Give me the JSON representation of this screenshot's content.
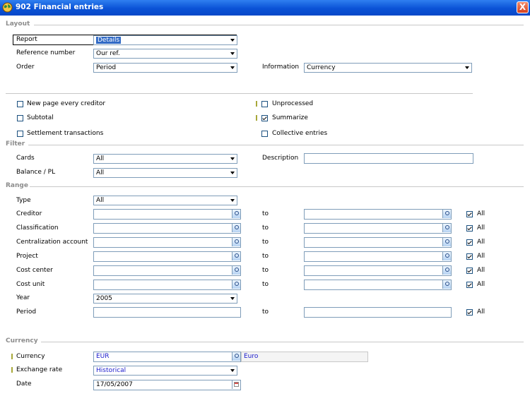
{
  "window": {
    "title": "902 Financial entries",
    "close_label": "X"
  },
  "layout": {
    "section_label": "Layout",
    "report": {
      "label": "Report",
      "value": "Details"
    },
    "reference_number": {
      "label": "Reference number",
      "value": "Our ref."
    },
    "order": {
      "label": "Order",
      "value": "Period"
    },
    "information": {
      "label": "Information",
      "value": "Currency"
    },
    "options": {
      "new_page_every_creditor": "New page every creditor",
      "subtotal": "Subtotal",
      "settlement_transactions": "Settlement transactions",
      "unprocessed": "Unprocessed",
      "summarize": "Summarize",
      "collective_entries": "Collective entries"
    },
    "checked": {
      "summarize": true
    }
  },
  "filter": {
    "section_label": "Filter",
    "cards": {
      "label": "Cards",
      "value": "All"
    },
    "balance_pl": {
      "label": "Balance / PL",
      "value": "All"
    },
    "description": {
      "label": "Description",
      "value": ""
    }
  },
  "range": {
    "section_label": "Range",
    "type": {
      "label": "Type",
      "value": "All"
    },
    "to_label": "to",
    "all_label": "All",
    "rows": [
      {
        "label": "Creditor"
      },
      {
        "label": "Classification"
      },
      {
        "label": "Centralization account"
      },
      {
        "label": "Project"
      },
      {
        "label": "Cost center"
      },
      {
        "label": "Cost unit"
      }
    ],
    "year": {
      "label": "Year",
      "value": "2005"
    },
    "period": {
      "label": "Period"
    }
  },
  "currency": {
    "section_label": "Currency",
    "currency": {
      "label": "Currency",
      "value": "EUR",
      "description": "Euro"
    },
    "exchange_rate": {
      "label": "Exchange rate",
      "value": "Historical"
    },
    "date": {
      "label": "Date",
      "value": "17/05/2007"
    }
  },
  "colors": {
    "titlebar": "#0a52d6",
    "value_text": "#1a1acc",
    "selection": "#316ac5",
    "required_marker": "#a8a83a"
  },
  "icons": {
    "app": "globe-icon",
    "lookup": "magnifier-icon",
    "date": "calendar-icon",
    "dropdown": "chevron-down-icon"
  }
}
